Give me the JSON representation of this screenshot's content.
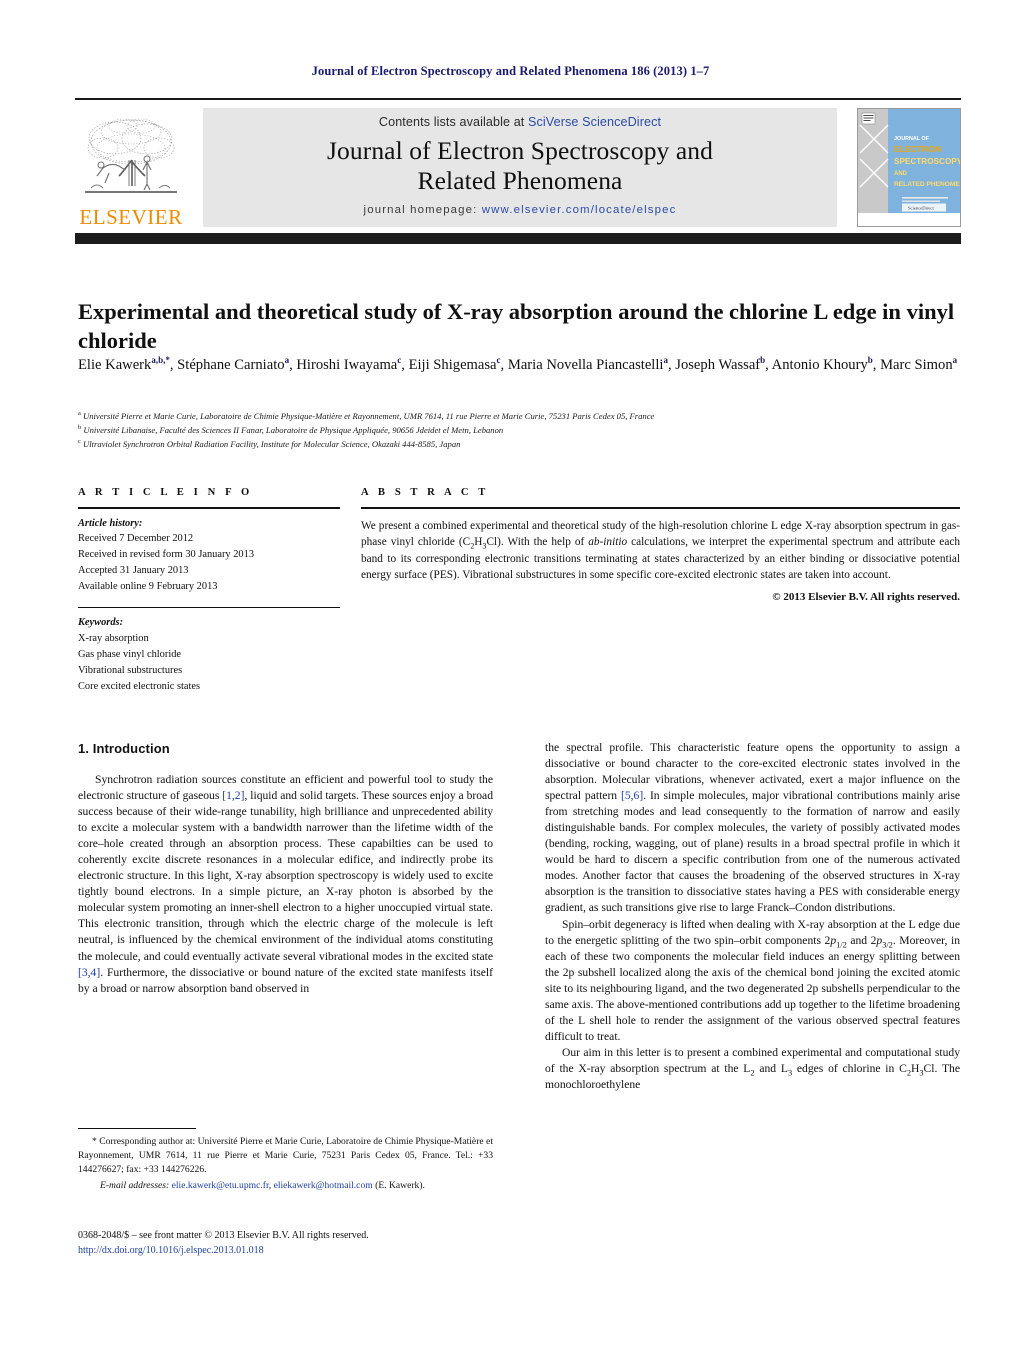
{
  "running_head": "Journal of Electron Spectroscopy and Related Phenomena 186 (2013) 1–7",
  "masthead": {
    "contents_prefix": "Contents lists available at ",
    "contents_link": "SciVerse ScienceDirect",
    "journal_title_line1": "Journal of Electron Spectroscopy and",
    "journal_title_line2": "Related Phenomena",
    "homepage_prefix": "journal homepage: ",
    "homepage_url": "www.elsevier.com/locate/elspec",
    "publisher_logo_text": "ELSEVIER",
    "cover": {
      "line1": "JOURNAL OF",
      "line2": "ELECTRON",
      "line3": "SPECTROSCOPY",
      "line4": "AND",
      "line5": "RELATED PHENOMENA",
      "bg_color": "#7fb3de",
      "accent_color": "#f0a500",
      "highlight_color": "#ffd966"
    }
  },
  "title": "Experimental and theoretical study of X-ray absorption around the chlorine L edge in vinyl chloride",
  "authors": [
    {
      "name": "Elie Kawerk",
      "sup": "a,b,*"
    },
    {
      "name": "Stéphane Carniato",
      "sup": "a"
    },
    {
      "name": "Hiroshi Iwayama",
      "sup": "c"
    },
    {
      "name": "Eiji Shigemasa",
      "sup": "c"
    },
    {
      "name": "Maria Novella Piancastelli",
      "sup": "a"
    },
    {
      "name": "Joseph Wassaf",
      "sup": "b"
    },
    {
      "name": "Antonio Khoury",
      "sup": "b"
    },
    {
      "name": "Marc Simon",
      "sup": "a"
    }
  ],
  "affiliations": [
    {
      "mark": "a",
      "text": "Université Pierre et Marie Curie, Laboratoire de Chimie Physique-Matière et Rayonnement, UMR 7614, 11 rue Pierre et Marie Curie, 75231 Paris Cedex 05, France"
    },
    {
      "mark": "b",
      "text": "Université Libanaise, Faculté des Sciences II Fanar, Laboratoire de Physique Appliquée, 90656 Jdeidet el Metn, Lebanon"
    },
    {
      "mark": "c",
      "text": "Ultraviolet Synchrotron Orbital Radiation Facility, Institute for Molecular Science, Okazaki 444-8585, Japan"
    }
  ],
  "article_info": {
    "heading": "A R T I C L E    I N F O",
    "history_label": "Article history:",
    "history": [
      "Received 7 December 2012",
      "Received in revised form 30 January 2013",
      "Accepted 31 January 2013",
      "Available online 9 February 2013"
    ],
    "keywords_label": "Keywords:",
    "keywords": [
      "X-ray absorption",
      "Gas phase vinyl chloride",
      "Vibrational substructures",
      "Core excited electronic states"
    ]
  },
  "abstract": {
    "heading": "A B S T R A C T",
    "text": "We present a combined experimental and theoretical study of the high-resolution chlorine L edge X-ray absorption spectrum in gas-phase vinyl chloride (C2H3Cl). With the help of ab-initio calculations, we interpret the experimental spectrum and attribute each band to its corresponding electronic transitions terminating at states characterized by an either binding or dissociative potential energy surface (PES). Vibrational substructures in some specific core-excited electronic states are taken into account.",
    "copyright": "© 2013 Elsevier B.V. All rights reserved."
  },
  "body": {
    "section_heading": "1.  Introduction",
    "left_paragraphs": [
      "Synchrotron radiation sources constitute an efficient and powerful tool to study the electronic structure of gaseous [1,2], liquid and solid targets. These sources enjoy a broad success because of their wide-range tunability, high brilliance and unprecedented ability to excite a molecular system with a bandwidth narrower than the lifetime width of the core–hole created through an absorption process. These capabilties can be used to coherently excite discrete resonances in a molecular edifice, and indirectly probe its electronic structure. In this light, X-ray absorption spectroscopy is widely used to excite tightly bound electrons. In a simple picture, an X-ray photon is absorbed by the molecular system promoting an inner-shell electron to a higher unoccupied virtual state. This electronic transition, through which the electric charge of the molecule is left neutral, is influenced by the chemical environment of the individual atoms constituting the molecule, and could eventually activate several vibrational modes in the excited state [3,4]. Furthermore, the dissociative or bound nature of the excited state manifests itself by a broad or narrow absorption band observed in"
    ],
    "right_paragraphs": [
      "the spectral profile. This characteristic feature opens the opportunity to assign a dissociative or bound character to the core-excited electronic states involved in the absorption. Molecular vibrations, whenever activated, exert a major influence on the spectral pattern [5,6]. In simple molecules, major vibrational contributions mainly arise from stretching modes and lead consequently to the formation of narrow and easily distinguishable bands. For complex molecules, the variety of possibly activated modes (bending, rocking, wagging, out of plane) results in a broad spectral profile in which it would be hard to discern a specific contribution from one of the numerous activated modes. Another factor that causes the broadening of the observed structures in X-ray absorption is the transition to dissociative states having a PES with considerable energy gradient, as such transitions give rise to large Franck–Condon distributions.",
      "Spin–orbit degeneracy is lifted when dealing with X-ray absorption at the L edge due to the energetic splitting of the two spin–orbit components 2p1/2 and 2p3/2. Moreover, in each of these two components the molecular field induces an energy splitting between the 2p subshell localized along the axis of the chemical bond joining the excited atomic site to its neighbouring ligand, and the two degenerated 2p subshells perpendicular to the same axis. The above-mentioned contributions add up together to the lifetime broadening of the L shell hole to render the assignment of the various observed spectral features difficult to treat.",
      "Our aim in this letter is to present a combined experimental and computational study of the X-ray absorption spectrum at the L2 and L3 edges of chlorine in C2H3Cl. The monochloroethylene"
    ]
  },
  "footnote": {
    "corresponding": "* Corresponding author at: Université Pierre et Marie Curie, Laboratoire de Chimie Physique-Matière et Rayonnement, UMR 7614, 11 rue Pierre et Marie Curie, 75231 Paris Cedex 05, France. Tel.: +33 144276627; fax: +33 144276226.",
    "email_label": "E-mail addresses:",
    "email1": "elie.kawerk@etu.upmc.fr",
    "email2": "eliekawerk@hotmail.com",
    "email_attrib": "(E. Kawerk)."
  },
  "issn_line": "0368-2048/$ – see front matter © 2013 Elsevier B.V. All rights reserved.",
  "doi_line": "http://dx.doi.org/10.1016/j.elspec.2013.01.018"
}
